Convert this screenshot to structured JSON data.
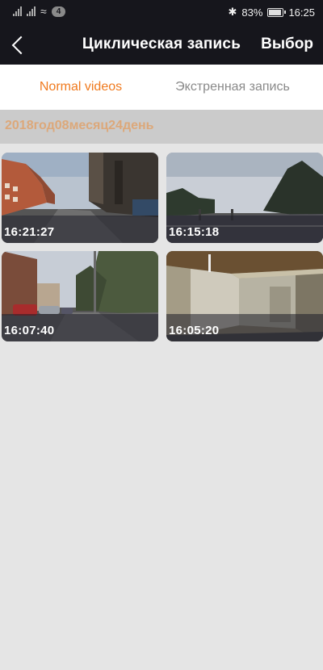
{
  "status_bar": {
    "wifi_badge": "4",
    "battery": "83%",
    "battery_level": 0.83,
    "time": "16:25"
  },
  "nav": {
    "title": "Циклическая запись",
    "select_label": "Выбор"
  },
  "tabs": [
    {
      "label": "Normal videos",
      "active": true
    },
    {
      "label": "Экстренная запись",
      "active": false
    }
  ],
  "sections": [
    {
      "date": "2018год08месяц24день",
      "videos": [
        {
          "time": "16:21:27"
        },
        {
          "time": "16:15:18"
        },
        {
          "time": "16:07:40"
        },
        {
          "time": "16:05:20"
        }
      ]
    }
  ],
  "colors": {
    "accent": "#f07a1e",
    "date_header_text": "#dca87a",
    "bar_background": "#16161c"
  }
}
